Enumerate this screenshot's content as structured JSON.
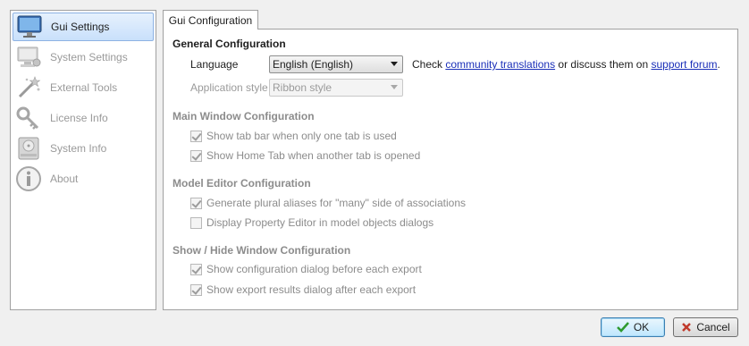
{
  "sidebar": {
    "items": [
      {
        "label": "Gui Settings",
        "icon": "monitor-icon",
        "selected": true
      },
      {
        "label": "System Settings",
        "icon": "computer-settings-icon"
      },
      {
        "label": "External Tools",
        "icon": "magic-wand-icon"
      },
      {
        "label": "License Info",
        "icon": "key-icon"
      },
      {
        "label": "System Info",
        "icon": "hard-drive-icon"
      },
      {
        "label": "About",
        "icon": "info-icon"
      }
    ]
  },
  "tab": {
    "label": "Gui Configuration"
  },
  "general": {
    "title": "General Configuration",
    "language_label": "Language",
    "language_value": "English (English)",
    "check_text": "Check",
    "community_link": "community translations",
    "or_text": "or discuss them on",
    "support_link": "support forum",
    "period": ".",
    "style_label": "Application style",
    "style_value": "Ribbon style"
  },
  "main_window": {
    "title": "Main Window Configuration",
    "opt1": "Show tab bar when only one tab is used",
    "opt2": "Show Home Tab when another tab is opened"
  },
  "model_editor": {
    "title": "Model Editor Configuration",
    "opt1": "Generate plural aliases for \"many\" side of associations",
    "opt2": "Display Property Editor in model objects dialogs"
  },
  "show_hide": {
    "title": "Show / Hide Window Configuration",
    "opt1": "Show configuration dialog before each export",
    "opt2": "Show export results dialog after each export"
  },
  "buttons": {
    "ok": "OK",
    "cancel": "Cancel"
  },
  "colors": {
    "selection": "#c9e0fb",
    "link": "#1a2fb8",
    "ok_check": "#2e9a2e",
    "cancel_x": "#c0392b"
  }
}
